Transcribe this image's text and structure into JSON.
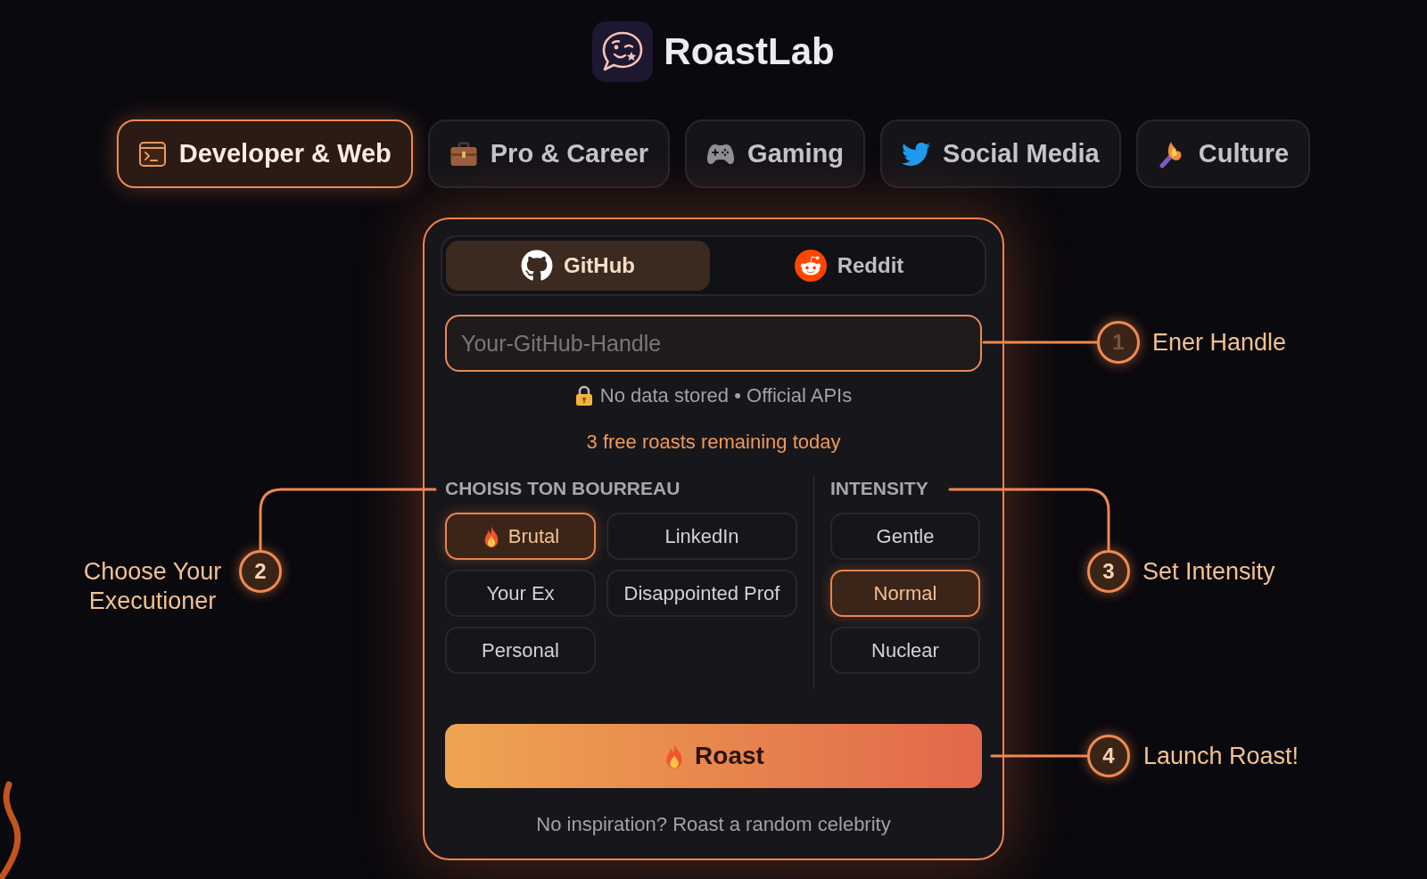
{
  "app": {
    "name": "RoastLab"
  },
  "categories": [
    {
      "label": "Developer & Web",
      "selected": true
    },
    {
      "label": "Pro & Career",
      "selected": false
    },
    {
      "label": "Gaming",
      "selected": false
    },
    {
      "label": "Social Media",
      "selected": false
    },
    {
      "label": "Culture",
      "selected": false
    }
  ],
  "platforms": [
    {
      "label": "GitHub",
      "selected": true
    },
    {
      "label": "Reddit",
      "selected": false
    }
  ],
  "handle_field": {
    "placeholder": "Your-GitHub-Handle"
  },
  "privacy_note": "No data stored • Official APIs",
  "quota_note": "3 free roasts remaining today",
  "executioner": {
    "title": "CHOISIS TON BOURREAU",
    "options": [
      {
        "label": "Brutal",
        "selected": true
      },
      {
        "label": "LinkedIn",
        "selected": false
      },
      {
        "label": "Your Ex",
        "selected": false
      },
      {
        "label": "Disappointed Prof",
        "selected": false
      },
      {
        "label": "Personal",
        "selected": false
      }
    ]
  },
  "intensity": {
    "title": "INTENSITY",
    "options": [
      {
        "label": "Gentle",
        "selected": false
      },
      {
        "label": "Normal",
        "selected": true
      },
      {
        "label": "Nuclear",
        "selected": false
      }
    ]
  },
  "roast_button": {
    "label": "Roast"
  },
  "random_link": "No inspiration? Roast a random celebrity",
  "callouts": [
    {
      "number": "1",
      "label": "Ener Handle",
      "dimmed": true
    },
    {
      "number": "2",
      "label": "Choose Your Executioner",
      "dimmed": false
    },
    {
      "number": "3",
      "label": "Set Intensity",
      "dimmed": false
    },
    {
      "number": "4",
      "label": "Launch Roast!",
      "dimmed": false
    }
  ]
}
